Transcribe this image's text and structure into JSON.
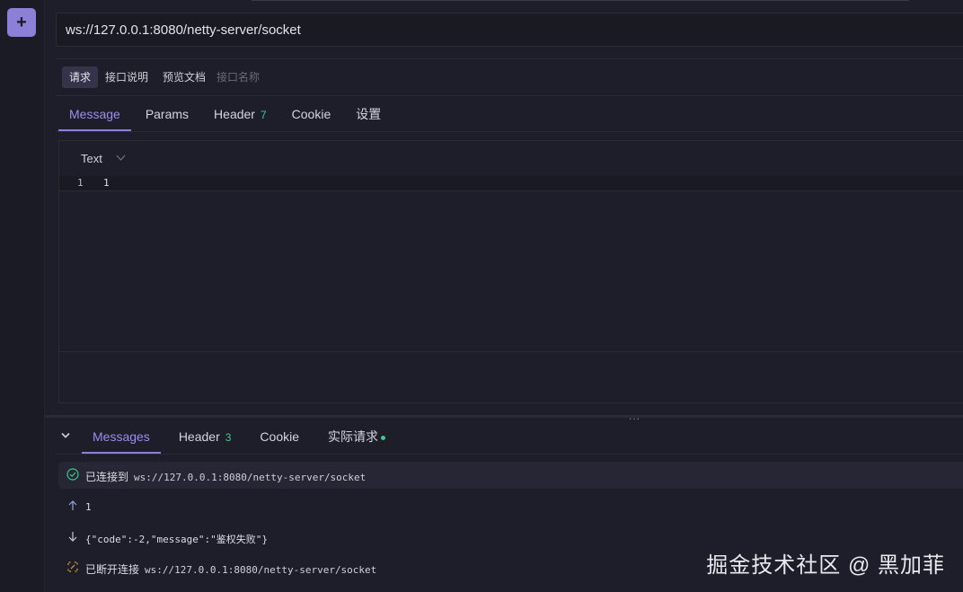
{
  "sidebar": {
    "add_label": "+"
  },
  "url": {
    "value": "ws://127.0.0.1:8080/netty-server/socket"
  },
  "request_tabs": [
    {
      "label": "请求"
    },
    {
      "label": "接口说明"
    },
    {
      "label": "预览文档"
    },
    {
      "label": "接口名称"
    }
  ],
  "message_tabs": [
    {
      "label": "Message"
    },
    {
      "label": "Params"
    },
    {
      "label": "Header",
      "badge": "7"
    },
    {
      "label": "Cookie"
    },
    {
      "label": "设置"
    }
  ],
  "editor": {
    "format": "Text",
    "line_number": "1",
    "content": "1"
  },
  "splitter": {
    "grip": "..."
  },
  "response_tabs": [
    {
      "label": "Messages"
    },
    {
      "label": "Header",
      "badge": "3"
    },
    {
      "label": "Cookie"
    },
    {
      "label": "实际请求"
    }
  ],
  "log": {
    "connected_label": "已连接到",
    "connected_url": "ws://127.0.0.1:8080/netty-server/socket",
    "sent_message": "1",
    "received_message": "{\"code\":-2,\"message\":\"鉴权失败\"}",
    "disconnected_label": "已断开连接",
    "disconnected_url": "ws://127.0.0.1:8080/netty-server/socket"
  },
  "watermark": "掘金技术社区 @ 黑加菲",
  "colors": {
    "accent": "#8b7fd8",
    "success": "#3cc98a",
    "warning": "#e0a030",
    "background": "#1e1e2a"
  }
}
